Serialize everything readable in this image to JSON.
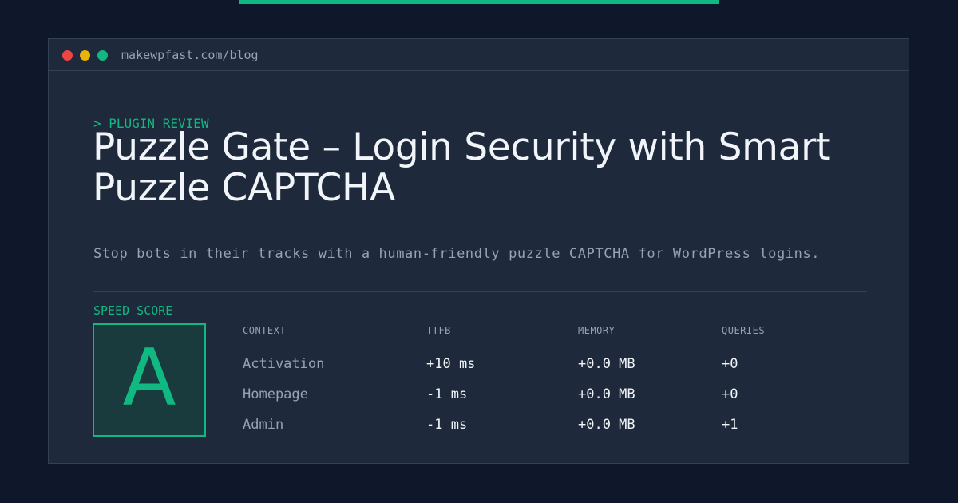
{
  "window": {
    "url": "makewpfast.com/blog"
  },
  "article": {
    "eyebrow": "> PLUGIN REVIEW",
    "title": "Puzzle Gate – Login Security with Smart Puzzle CAPTCHA",
    "subtitle": "Stop bots in their tracks with a human-friendly puzzle CAPTCHA for WordPress logins."
  },
  "speed_score": {
    "label": "SPEED SCORE",
    "grade": "A"
  },
  "metrics": {
    "headers": [
      "CONTEXT",
      "TTFB",
      "MEMORY",
      "QUERIES"
    ],
    "rows": [
      {
        "context": "Activation",
        "ttfb": "+10 ms",
        "memory": "+0.0 MB",
        "queries": "+0"
      },
      {
        "context": "Homepage",
        "ttfb": "-1 ms",
        "memory": "+0.0 MB",
        "queries": "+0"
      },
      {
        "context": "Admin",
        "ttfb": "-1 ms",
        "memory": "+0.0 MB",
        "queries": "+1"
      }
    ]
  },
  "colors": {
    "accent": "#10b981",
    "background": "#0f172a",
    "panel": "#1e293b",
    "text": "#f1f5f9",
    "muted": "#94a3b8"
  }
}
